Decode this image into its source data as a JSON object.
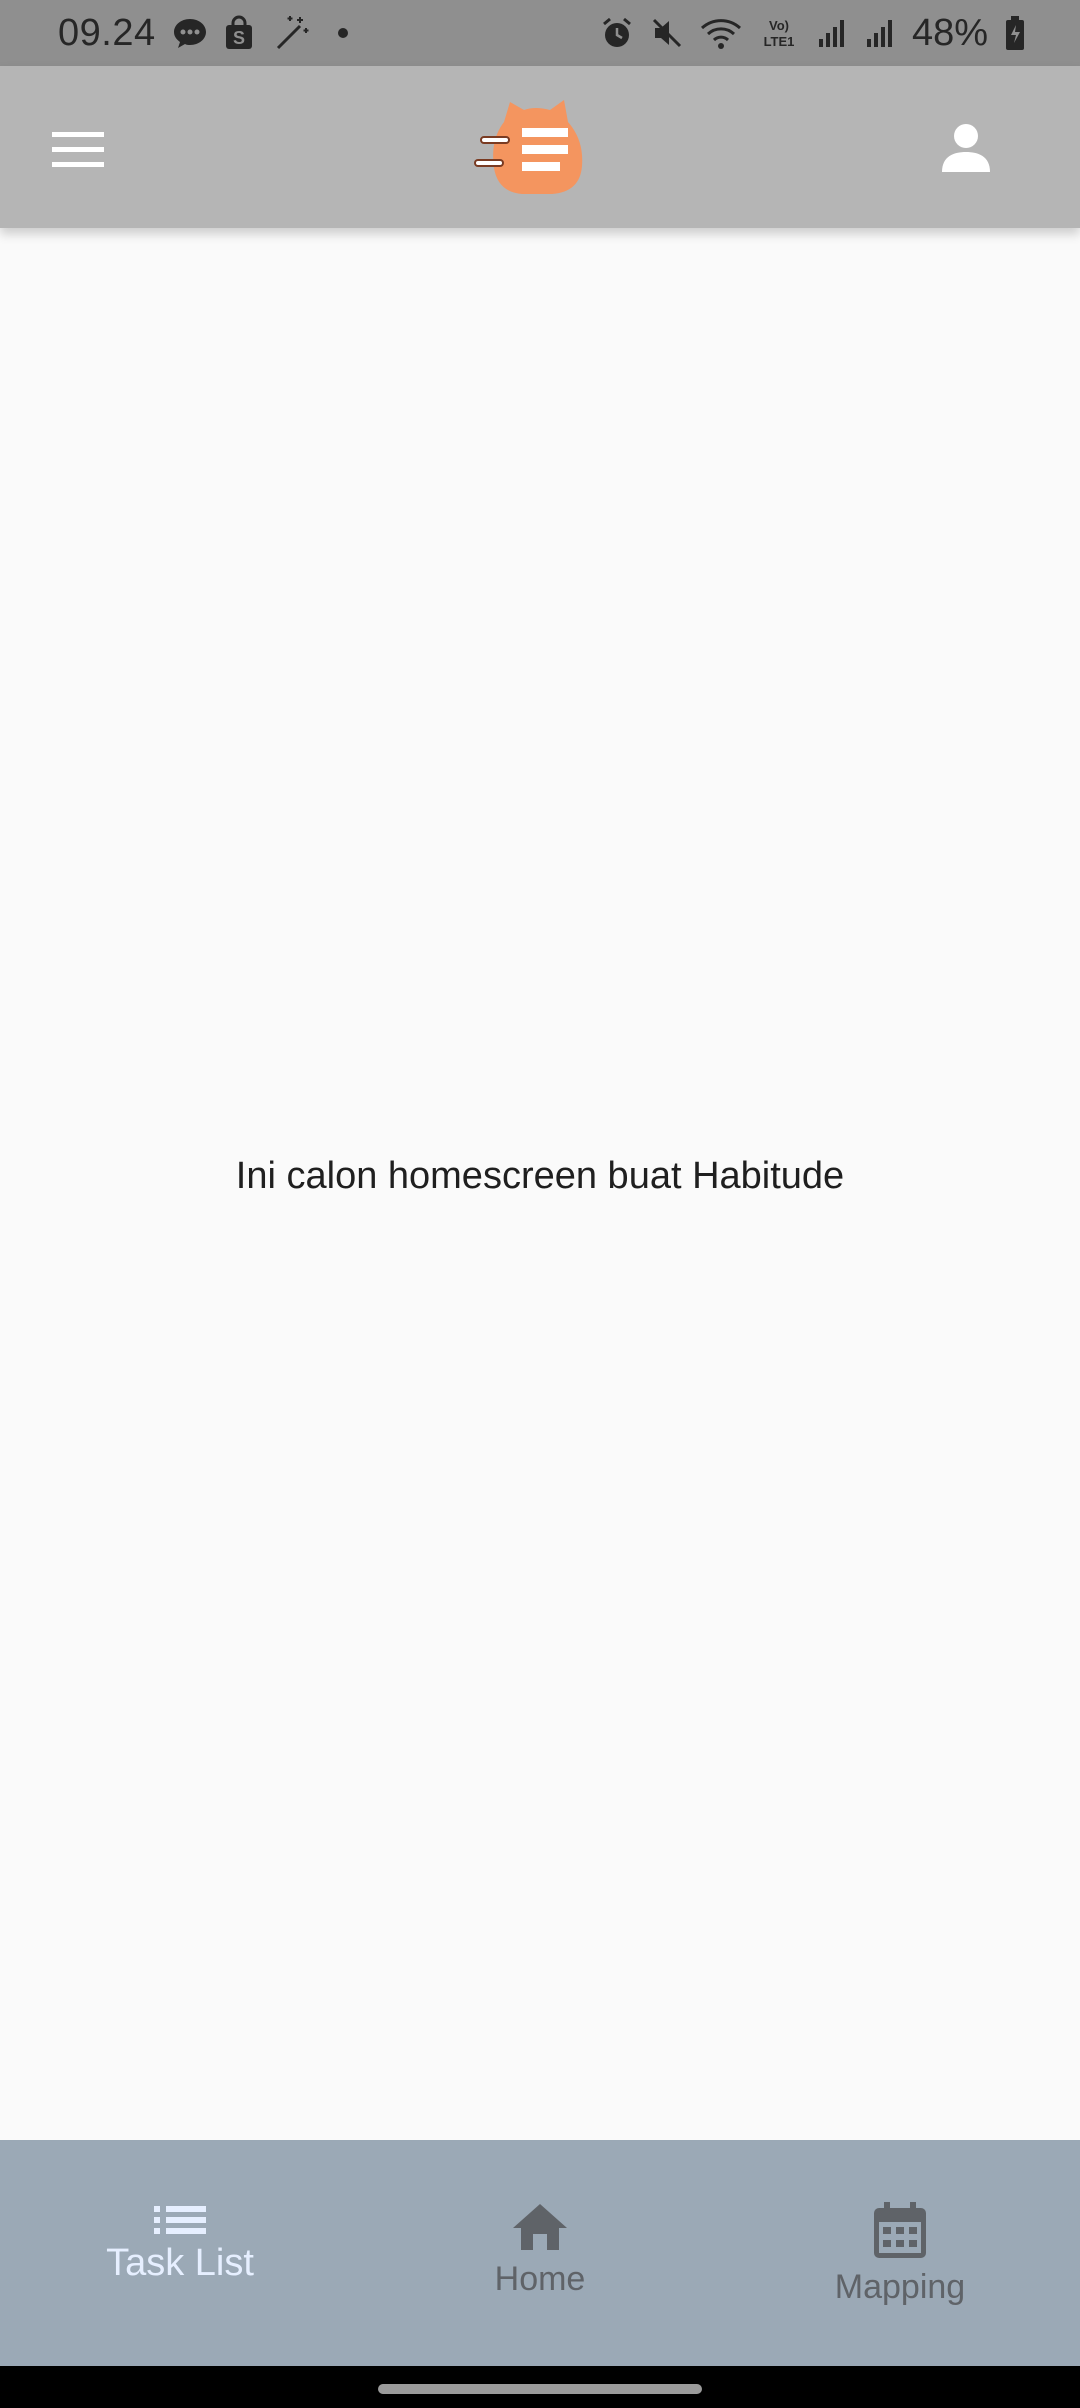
{
  "status_bar": {
    "time": "09.24",
    "battery_percent": "48%",
    "left_icons": [
      "chat-bubble-icon",
      "shopee-bag-icon",
      "magic-wand-icon",
      "notification-dot-icon"
    ],
    "right_icons": [
      "alarm-icon",
      "mute-icon",
      "wifi-icon",
      "volte-icon",
      "signal-icon",
      "signal-icon",
      "battery-icon"
    ]
  },
  "app_bar": {
    "menu_icon": "hamburger-menu-icon",
    "logo": "habitude-logo",
    "account_icon": "person-icon",
    "background": "#b5b5b5",
    "logo_color": "#f4955f"
  },
  "main": {
    "message": "Ini calon homescreen buat Habitude"
  },
  "bottom_nav": {
    "background": "#9ba9b6",
    "items": [
      {
        "label": "Task List",
        "icon": "list-icon",
        "active": true
      },
      {
        "label": "Home",
        "icon": "home-icon",
        "active": false
      },
      {
        "label": "Mapping",
        "icon": "calendar-icon",
        "active": false
      }
    ]
  }
}
